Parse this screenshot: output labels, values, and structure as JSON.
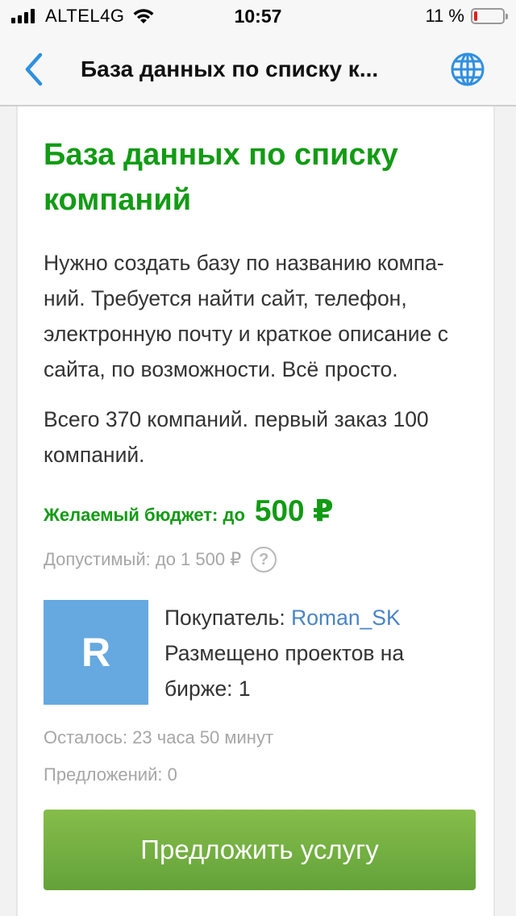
{
  "status_bar": {
    "carrier": "ALTEL4G",
    "time": "10:57",
    "battery_percent": "11 %",
    "battery_level": 0.11,
    "icons": [
      "signal-icon",
      "wifi-icon",
      "battery-icon"
    ]
  },
  "nav": {
    "back_icon": "chevron-left-icon",
    "title": "База данных по списку к...",
    "globe_icon": "globe-icon",
    "accent_color": "#2f8fe0"
  },
  "project": {
    "title": "База данных по списку компаний",
    "description": "Нужно создать базу по названию компа-ний. Требуется найти сайт, телефон, электронную почту и краткое описание с сайта, по возможности. Всё просто.",
    "description2": "Всего 370 компаний. первый заказ 100 компаний.",
    "budget_label": "Желаемый бюджет: до",
    "budget_value": "500 ₽",
    "allowed": "Допустимый: до 1 500 ₽",
    "help_symbol": "?",
    "title_color": "#129b14"
  },
  "buyer": {
    "avatar_letter": "R",
    "avatar_color": "#65a9e0",
    "label": "Покупатель: ",
    "name": "Roman_SK",
    "projects": "Размещено проектов на бирже: 1"
  },
  "meta": {
    "remaining": "Осталось: 23 часа 50 минут",
    "offers": "Предложений: 0"
  },
  "actions": {
    "offer_button": "Предложить услугу",
    "button_color": "#74b043"
  }
}
